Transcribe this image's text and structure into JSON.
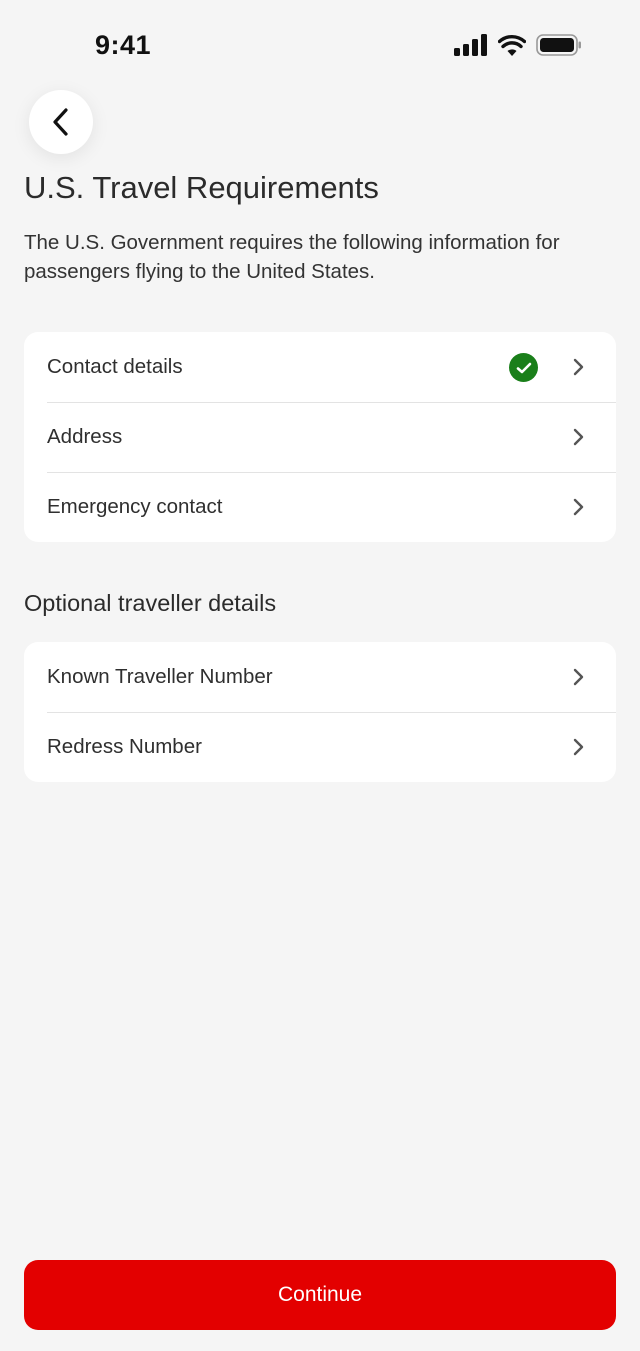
{
  "status_bar": {
    "time": "9:41",
    "icons": [
      "signal-icon",
      "wifi-icon",
      "battery-icon"
    ]
  },
  "header": {
    "back_icon": "chevron-left-icon",
    "title": "U.S. Travel Requirements",
    "description": "The U.S. Government requires the following information for passengers flying to the United States."
  },
  "required_items": [
    {
      "label": "Contact details",
      "completed": true
    },
    {
      "label": "Address",
      "completed": false
    },
    {
      "label": "Emergency contact",
      "completed": false
    }
  ],
  "optional_section": {
    "title": "Optional traveller details",
    "items": [
      {
        "label": "Known Traveller Number"
      },
      {
        "label": "Redress Number"
      }
    ]
  },
  "footer": {
    "continue_label": "Continue"
  },
  "colors": {
    "accent": "#e30000",
    "success": "#1a7f1a",
    "background": "#f5f5f5"
  }
}
